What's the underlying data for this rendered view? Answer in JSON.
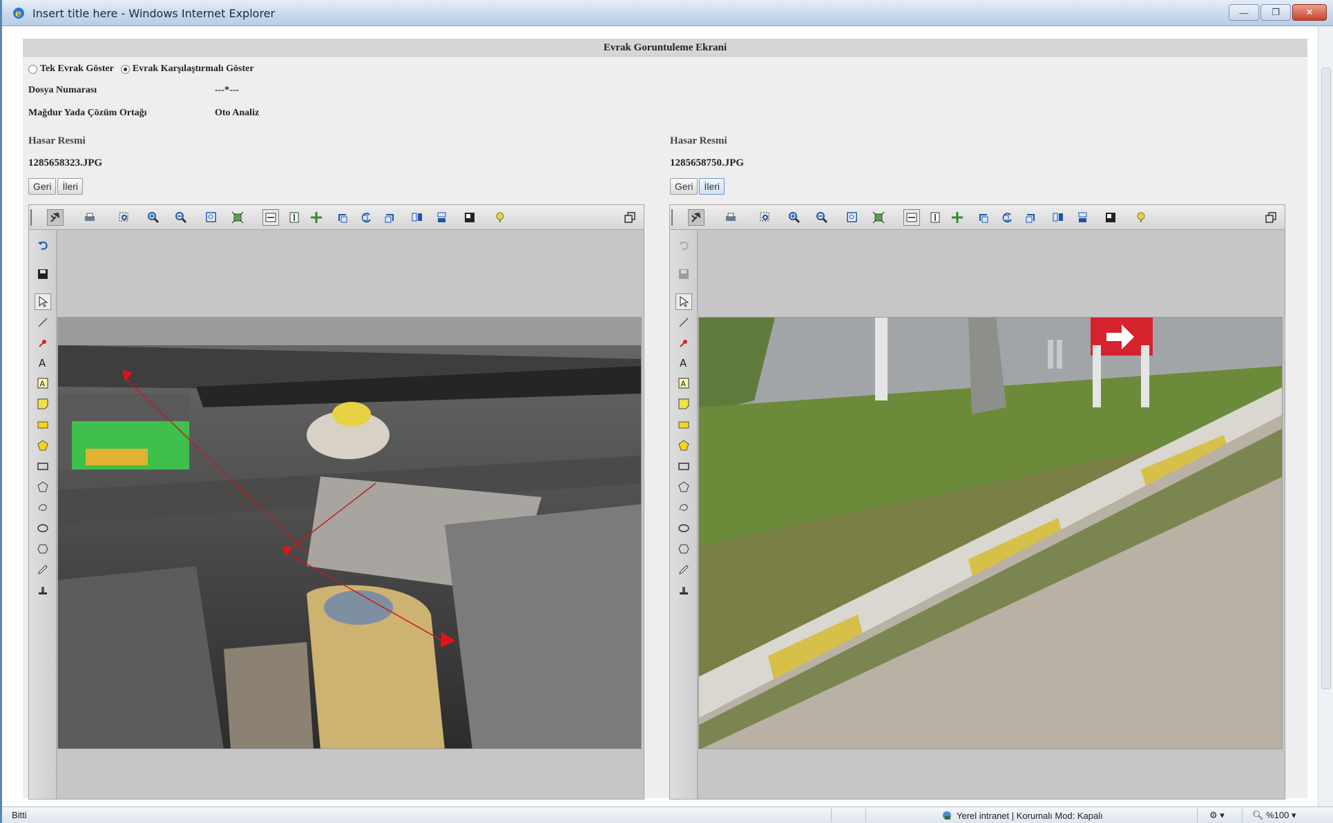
{
  "window": {
    "title": "Insert title here - Windows Internet Explorer"
  },
  "page": {
    "header": "Evrak Goruntuleme Ekrani",
    "view_mode": {
      "option_single": "Tek Evrak Göster",
      "option_compare": "Evrak Karşılaştırmalı Göster",
      "selected": "compare"
    },
    "fields": [
      {
        "label": "Dosya Numarası",
        "value": "---*---"
      },
      {
        "label": "Mağdur Yada Çözüm Ortağı",
        "value": "Oto Analiz"
      }
    ],
    "left_panel": {
      "section_title": "Hasar Resmi",
      "file_name": "1285658323.JPG",
      "prev_label": "Geri",
      "next_label": "İleri"
    },
    "right_panel": {
      "section_title": "Hasar Resmi",
      "file_name": "1285658750.JPG",
      "prev_label": "Geri",
      "next_label": "İleri"
    },
    "viewer_toolbar_icons": [
      "pan-tool-icon",
      "print-icon",
      "zoom-region-icon",
      "zoom-in-icon",
      "zoom-out-icon",
      "zoom-fit-icon",
      "fit-to-window-icon",
      "fit-width-icon",
      "fit-height-icon",
      "move-icon",
      "rotate-left-icon",
      "rotate-icon",
      "rotate-right-icon",
      "flip-horizontal-icon",
      "flip-vertical-icon",
      "invert-icon",
      "help-icon",
      "restore-window-icon"
    ],
    "viewer_side_icons": [
      "undo-icon",
      "save-icon",
      "select-arrow-icon",
      "line-icon",
      "pin-icon",
      "text-icon",
      "text-box-icon",
      "sticky-note-icon",
      "filled-rectangle-icon",
      "filled-polygon-icon",
      "rectangle-icon",
      "polygon-icon",
      "freehand-icon",
      "ellipse-icon",
      "hexagon-icon",
      "pen-icon",
      "stamp-icon"
    ]
  },
  "statusbar": {
    "left_text": "Bitti",
    "zone_text": "Yerel intranet | Korumalı Mod: Kapalı",
    "zoom_text": "%100"
  },
  "colors": {
    "accent": "#5a86b6",
    "toolbar": "#dedede",
    "canvas": "#c6c6c6"
  }
}
